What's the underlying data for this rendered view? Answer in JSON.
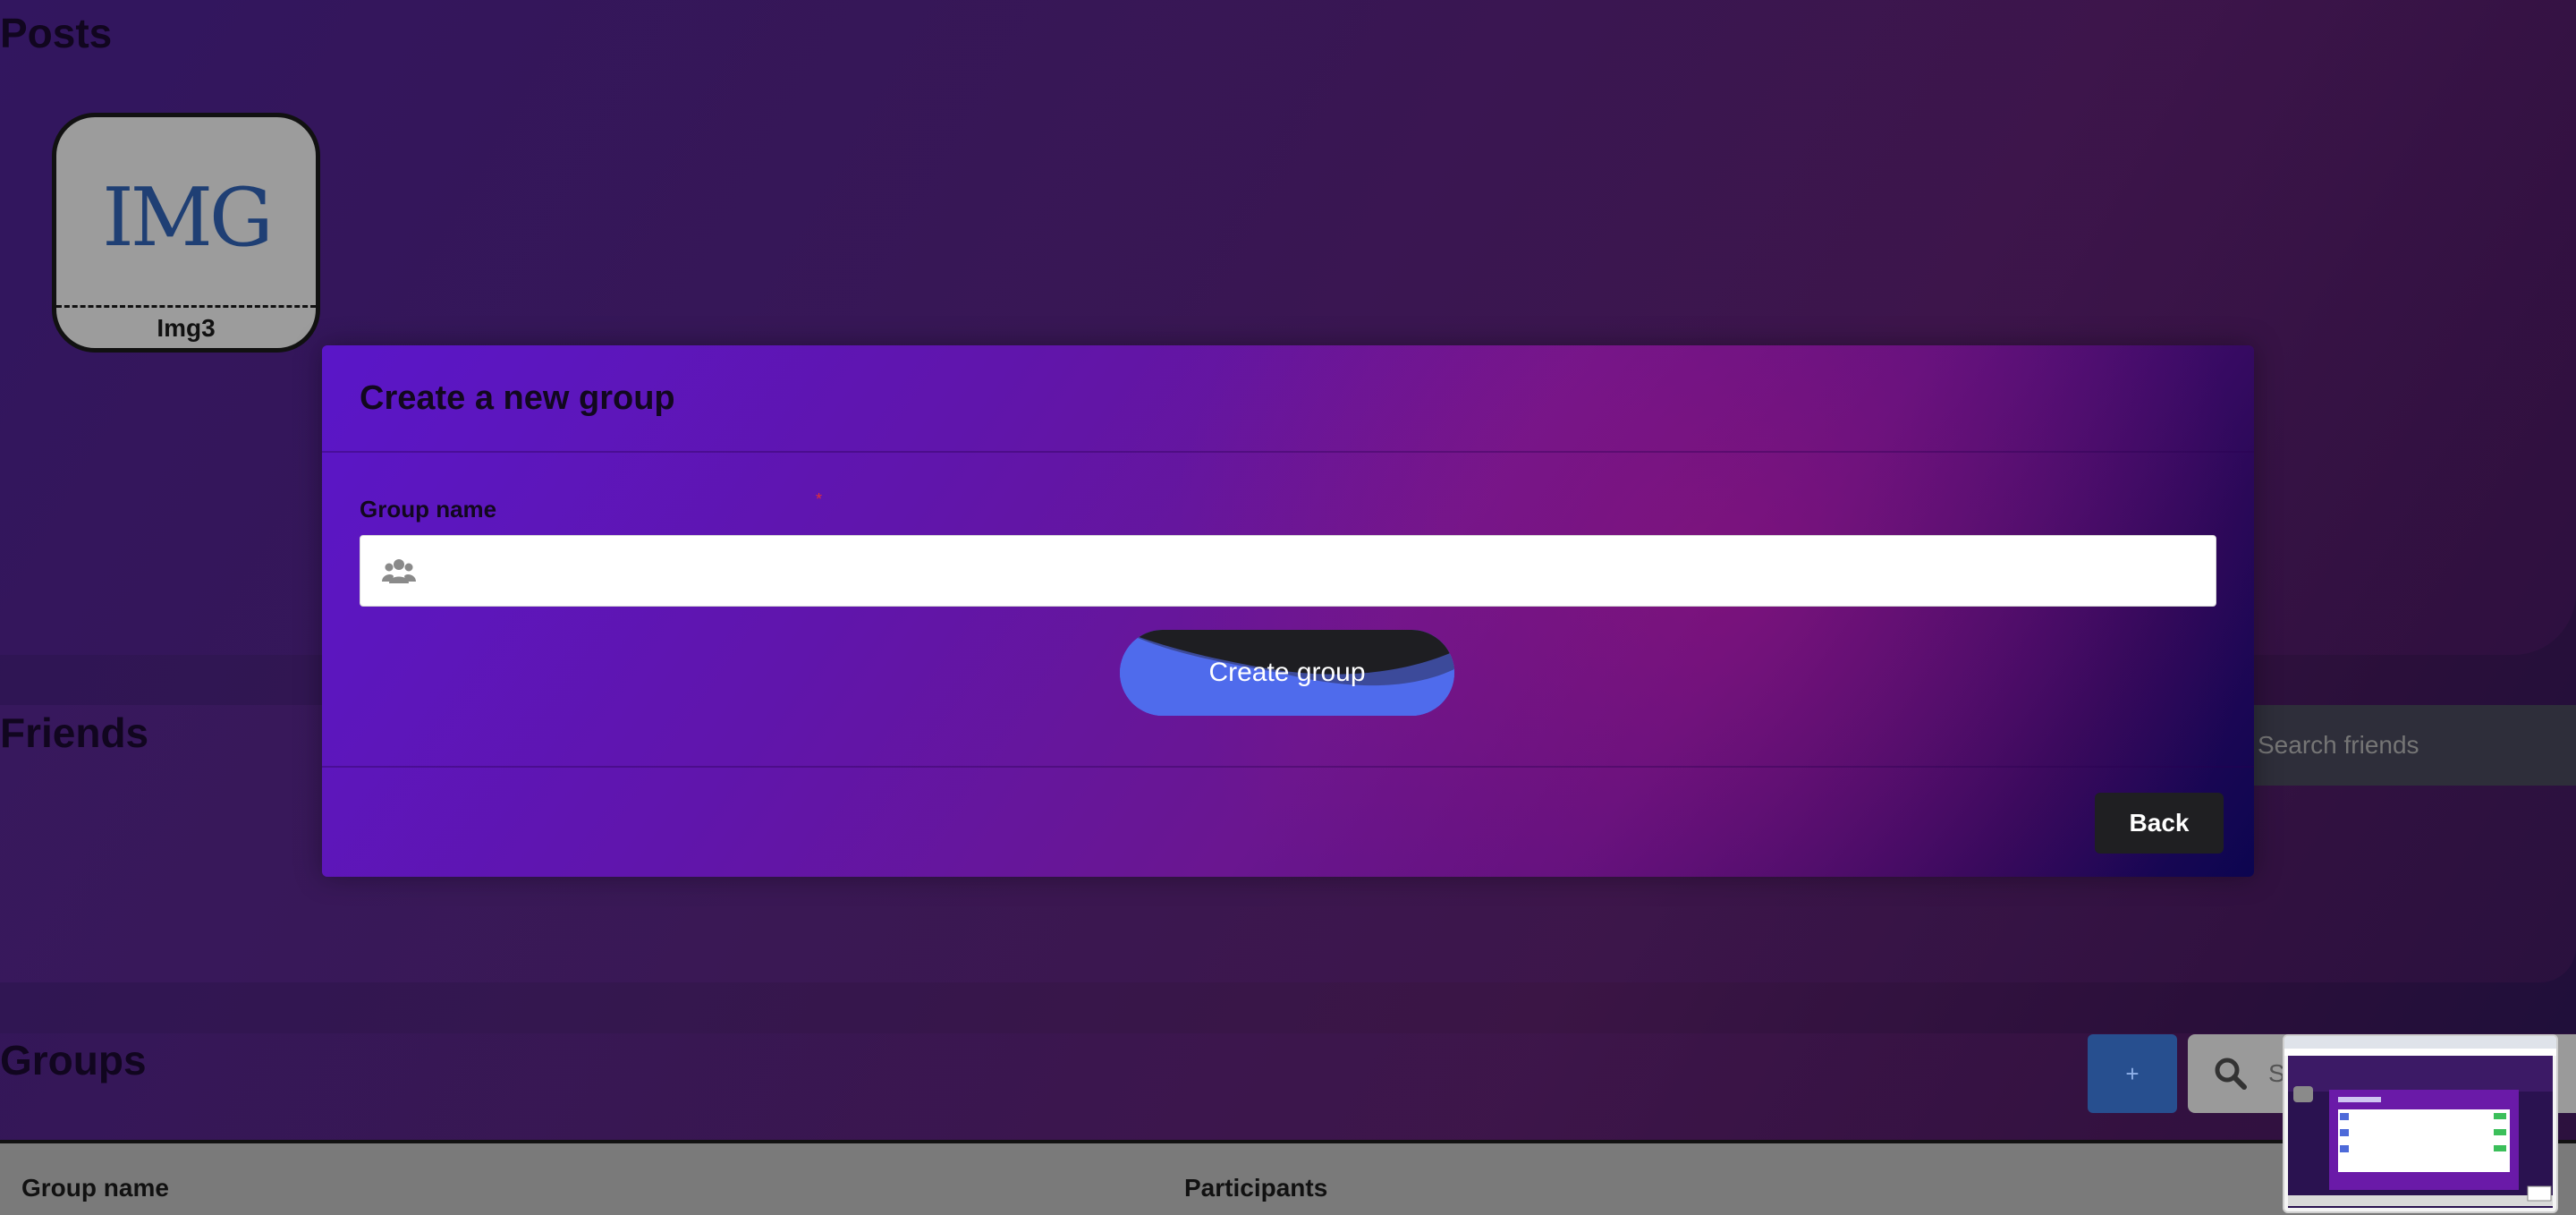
{
  "page": {
    "posts_title": "Posts",
    "friends_title": "Friends",
    "groups_title": "Groups"
  },
  "posts": [
    {
      "logo_text": "IMG",
      "caption": "Img3"
    }
  ],
  "friends": {
    "search_placeholder": "Search friends"
  },
  "groups": {
    "add_label": "+",
    "search_placeholder": "Se",
    "columns": [
      "Group name",
      "Participants"
    ]
  },
  "modal": {
    "title": "Create a new group",
    "field_label": "Group name",
    "required_marker": "*",
    "field_value": "",
    "create_label": "Create group",
    "back_label": "Back"
  },
  "icons": {
    "input_icon": "users-icon",
    "search_icon": "search-icon"
  },
  "colors": {
    "modal_gradient_start": "#5a16c8",
    "modal_gradient_end": "#0c0550",
    "create_button": "#4f6bec",
    "back_button": "#1f1f22",
    "required": "#e0303a"
  }
}
